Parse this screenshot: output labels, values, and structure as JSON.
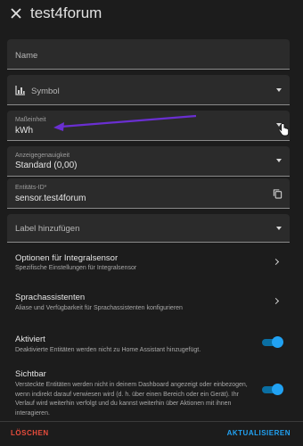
{
  "header": {
    "title": "test4forum",
    "close_icon": "close-icon"
  },
  "fields": {
    "name": {
      "placeholder": "Name"
    },
    "symbol": {
      "placeholder": "Symbol",
      "icon": "chart-icon"
    },
    "unit": {
      "label": "Maßeinheit",
      "value": "kWh"
    },
    "precision": {
      "label": "Anzeigegenauigkeit",
      "value": "Standard (0,00)"
    },
    "entity_id": {
      "label": "Entitäts-ID*",
      "value": "sensor.test4forum",
      "icon": "copy-icon"
    },
    "label": {
      "placeholder": "Label hinzufügen"
    }
  },
  "rows": {
    "integral": {
      "title": "Optionen für Integralsensor",
      "subtitle": "Spezifische Einstellungen für Integralsensor"
    },
    "voice": {
      "title": "Sprachassistenten",
      "subtitle": "Aliase und Verfügbarkeit für Sprachassistenten konfigurieren"
    },
    "enabled": {
      "title": "Aktiviert",
      "subtitle": "Deaktivierte Entitäten werden nicht zu Home Assistant hinzugefügt.",
      "on": true
    },
    "visible": {
      "title": "Sichtbar",
      "subtitle": "Versteckte Entitäten werden nicht in deinem Dashboard angezeigt oder einbezogen, wenn indirekt darauf verwiesen wird (d. h. über einen Bereich oder ein Gerät). Ihr Verlauf wird weiterhin verfolgt und du kannst weiterhin über Aktionen mit ihnen interagieren.",
      "on": true
    }
  },
  "footer": {
    "delete_label": "LÖSCHEN",
    "update_label": "AKTUALISIEREN"
  },
  "colors": {
    "accent": "#21a2f3",
    "danger": "#e74c3c",
    "annotation_arrow": "#6a2fd1"
  }
}
